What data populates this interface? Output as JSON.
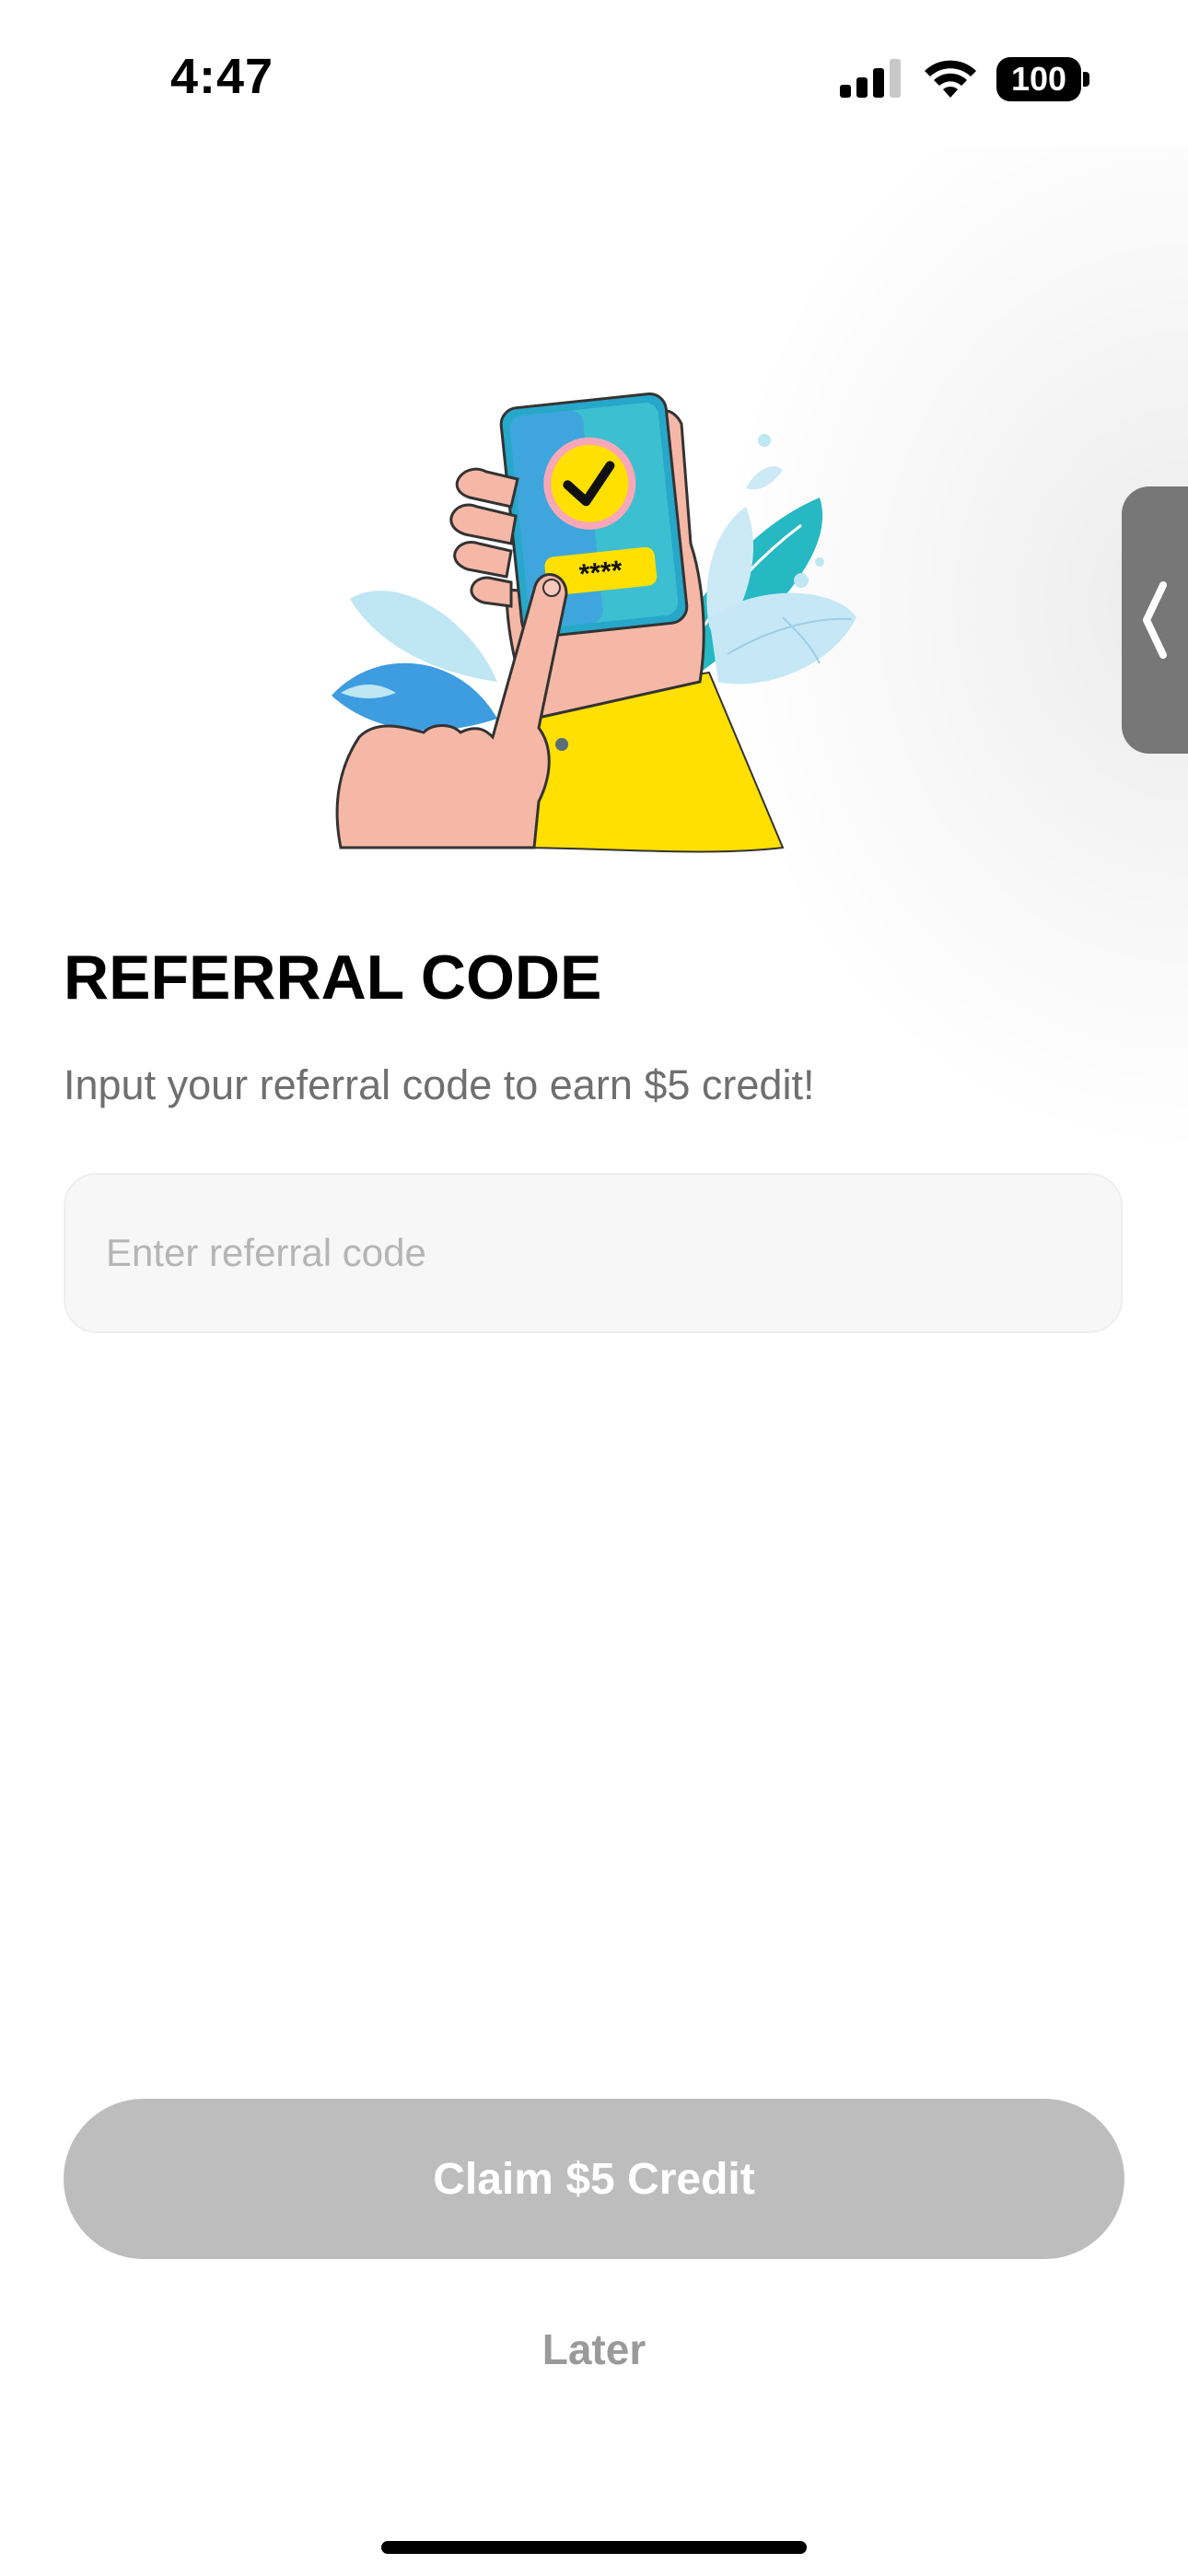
{
  "status_bar": {
    "time": "4:47",
    "battery": "100",
    "icons": [
      "signal-icon",
      "wifi-icon",
      "battery-icon"
    ]
  },
  "illustration": {
    "icon": "hand-phone-check-illustration",
    "code_mask": "****"
  },
  "referral": {
    "title": "REFERRAL CODE",
    "subtitle": "Input your referral code to earn $5 credit!",
    "input_placeholder": "Enter referral code",
    "input_value": ""
  },
  "actions": {
    "claim_label": "Claim $5 Credit",
    "later_label": "Later"
  },
  "colors": {
    "button_disabled": "#bdbdbd",
    "accent_yellow": "#FFE000",
    "phone_blue": "#3BA3E6",
    "leaf_teal": "#27BBC4"
  }
}
